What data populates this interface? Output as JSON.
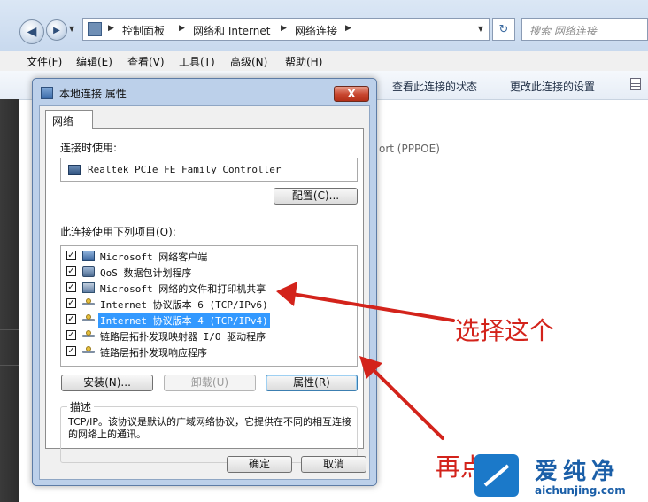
{
  "explorer": {
    "breadcrumb": [
      "控制面板",
      "网络和 Internet",
      "网络连接"
    ],
    "search_placeholder": "搜索 网络连接",
    "menu": [
      "文件(F)",
      "编辑(E)",
      "查看(V)",
      "工具(T)",
      "高级(N)",
      "帮助(H)"
    ],
    "commands": [
      "查看此连接的状态",
      "更改此连接的设置"
    ],
    "background_text": "ort (PPPOE)"
  },
  "dialog": {
    "title": "本地连接 属性",
    "close_label": "X",
    "tab": "网络",
    "connect_using_label": "连接时使用:",
    "adapter_name": "Realtek PCIe FE Family Controller",
    "configure_button": "配置(C)...",
    "items_label": "此连接使用下列项目(O):",
    "items": [
      {
        "label": "Microsoft 网络客户端",
        "checked": true,
        "icon": "network-client-icon"
      },
      {
        "label": "QoS 数据包计划程序",
        "checked": true,
        "icon": "qos-icon"
      },
      {
        "label": "Microsoft 网络的文件和打印机共享",
        "checked": true,
        "icon": "file-share-icon"
      },
      {
        "label": "Internet 协议版本 6 (TCP/IPv6)",
        "checked": true,
        "icon": "protocol-icon"
      },
      {
        "label": "Internet 协议版本 4 (TCP/IPv4)",
        "checked": true,
        "icon": "protocol-icon",
        "selected": true
      },
      {
        "label": "链路层拓扑发现映射器 I/O 驱动程序",
        "checked": true,
        "icon": "protocol-icon"
      },
      {
        "label": "链路层拓扑发现响应程序",
        "checked": true,
        "icon": "protocol-icon"
      }
    ],
    "install_button": "安装(N)...",
    "uninstall_button": "卸载(U)",
    "properties_button": "属性(R)",
    "description_title": "描述",
    "description_text": "TCP/IP。该协议是默认的广域网络协议，它提供在不同的相互连接的网络上的通讯。",
    "ok_button": "确定",
    "cancel_button": "取消"
  },
  "annotations": {
    "select_this": "选择这个",
    "then_click": "再点"
  },
  "watermark": {
    "name": "爱纯净",
    "url": "aichunjing.com"
  },
  "colors": {
    "selection": "#3399ff",
    "annotation_red": "#d3231b",
    "watermark_blue": "#1b79c9"
  }
}
